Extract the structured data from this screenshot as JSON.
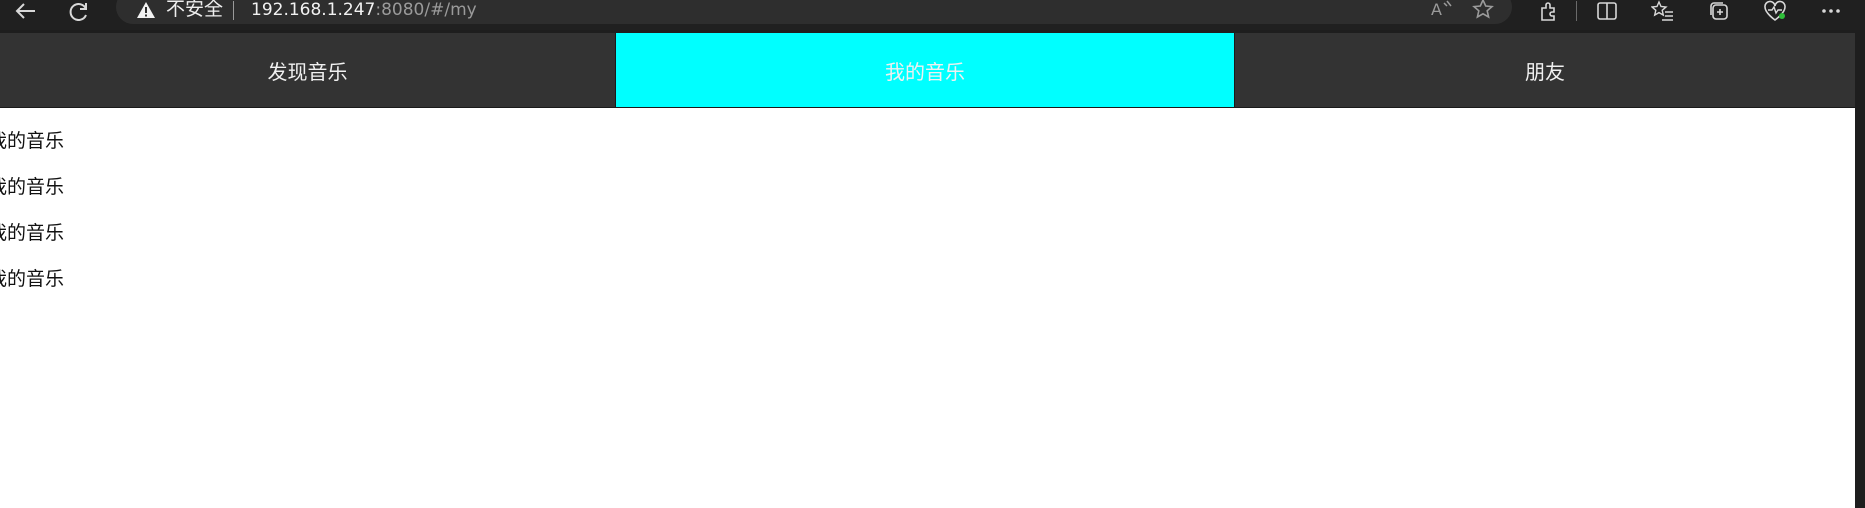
{
  "browser": {
    "insecure_label": "不安全",
    "url_host": "192.168.1.247",
    "url_rest": ":8080/#/my",
    "icons": [
      "back-arrow-icon",
      "refresh-icon",
      "warning-icon",
      "read-aloud-icon",
      "favorite-star-icon",
      "extensions-icon",
      "split-screen-icon",
      "favorites-list-icon",
      "collections-icon",
      "performance-icon",
      "more-icon"
    ]
  },
  "nav": {
    "tabs": [
      {
        "label": "发现音乐",
        "active": false
      },
      {
        "label": "我的音乐",
        "active": true
      },
      {
        "label": "朋友",
        "active": false
      }
    ],
    "active_color": "#00ffff",
    "inactive_color": "#333333"
  },
  "content": {
    "items": [
      "我的音乐",
      "我的音乐",
      "我的音乐",
      "我的音乐"
    ]
  }
}
